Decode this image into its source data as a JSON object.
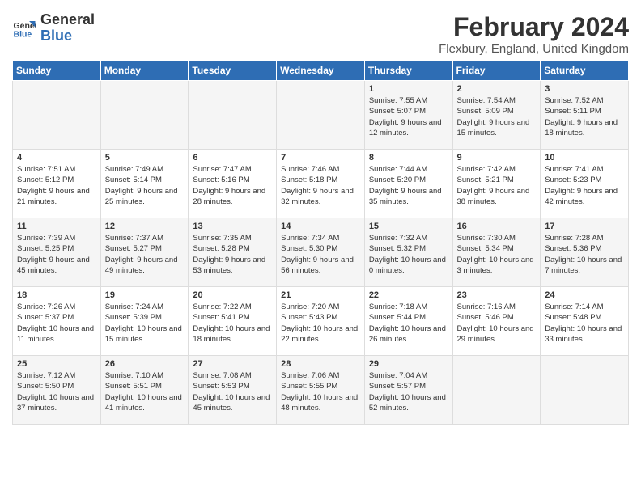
{
  "header": {
    "logo_line1": "General",
    "logo_line2": "Blue",
    "month_title": "February 2024",
    "location": "Flexbury, England, United Kingdom"
  },
  "weekdays": [
    "Sunday",
    "Monday",
    "Tuesday",
    "Wednesday",
    "Thursday",
    "Friday",
    "Saturday"
  ],
  "weeks": [
    [
      {
        "day": "",
        "sunrise": "",
        "sunset": "",
        "daylight": ""
      },
      {
        "day": "",
        "sunrise": "",
        "sunset": "",
        "daylight": ""
      },
      {
        "day": "",
        "sunrise": "",
        "sunset": "",
        "daylight": ""
      },
      {
        "day": "",
        "sunrise": "",
        "sunset": "",
        "daylight": ""
      },
      {
        "day": "1",
        "sunrise": "Sunrise: 7:55 AM",
        "sunset": "Sunset: 5:07 PM",
        "daylight": "Daylight: 9 hours and 12 minutes."
      },
      {
        "day": "2",
        "sunrise": "Sunrise: 7:54 AM",
        "sunset": "Sunset: 5:09 PM",
        "daylight": "Daylight: 9 hours and 15 minutes."
      },
      {
        "day": "3",
        "sunrise": "Sunrise: 7:52 AM",
        "sunset": "Sunset: 5:11 PM",
        "daylight": "Daylight: 9 hours and 18 minutes."
      }
    ],
    [
      {
        "day": "4",
        "sunrise": "Sunrise: 7:51 AM",
        "sunset": "Sunset: 5:12 PM",
        "daylight": "Daylight: 9 hours and 21 minutes."
      },
      {
        "day": "5",
        "sunrise": "Sunrise: 7:49 AM",
        "sunset": "Sunset: 5:14 PM",
        "daylight": "Daylight: 9 hours and 25 minutes."
      },
      {
        "day": "6",
        "sunrise": "Sunrise: 7:47 AM",
        "sunset": "Sunset: 5:16 PM",
        "daylight": "Daylight: 9 hours and 28 minutes."
      },
      {
        "day": "7",
        "sunrise": "Sunrise: 7:46 AM",
        "sunset": "Sunset: 5:18 PM",
        "daylight": "Daylight: 9 hours and 32 minutes."
      },
      {
        "day": "8",
        "sunrise": "Sunrise: 7:44 AM",
        "sunset": "Sunset: 5:20 PM",
        "daylight": "Daylight: 9 hours and 35 minutes."
      },
      {
        "day": "9",
        "sunrise": "Sunrise: 7:42 AM",
        "sunset": "Sunset: 5:21 PM",
        "daylight": "Daylight: 9 hours and 38 minutes."
      },
      {
        "day": "10",
        "sunrise": "Sunrise: 7:41 AM",
        "sunset": "Sunset: 5:23 PM",
        "daylight": "Daylight: 9 hours and 42 minutes."
      }
    ],
    [
      {
        "day": "11",
        "sunrise": "Sunrise: 7:39 AM",
        "sunset": "Sunset: 5:25 PM",
        "daylight": "Daylight: 9 hours and 45 minutes."
      },
      {
        "day": "12",
        "sunrise": "Sunrise: 7:37 AM",
        "sunset": "Sunset: 5:27 PM",
        "daylight": "Daylight: 9 hours and 49 minutes."
      },
      {
        "day": "13",
        "sunrise": "Sunrise: 7:35 AM",
        "sunset": "Sunset: 5:28 PM",
        "daylight": "Daylight: 9 hours and 53 minutes."
      },
      {
        "day": "14",
        "sunrise": "Sunrise: 7:34 AM",
        "sunset": "Sunset: 5:30 PM",
        "daylight": "Daylight: 9 hours and 56 minutes."
      },
      {
        "day": "15",
        "sunrise": "Sunrise: 7:32 AM",
        "sunset": "Sunset: 5:32 PM",
        "daylight": "Daylight: 10 hours and 0 minutes."
      },
      {
        "day": "16",
        "sunrise": "Sunrise: 7:30 AM",
        "sunset": "Sunset: 5:34 PM",
        "daylight": "Daylight: 10 hours and 3 minutes."
      },
      {
        "day": "17",
        "sunrise": "Sunrise: 7:28 AM",
        "sunset": "Sunset: 5:36 PM",
        "daylight": "Daylight: 10 hours and 7 minutes."
      }
    ],
    [
      {
        "day": "18",
        "sunrise": "Sunrise: 7:26 AM",
        "sunset": "Sunset: 5:37 PM",
        "daylight": "Daylight: 10 hours and 11 minutes."
      },
      {
        "day": "19",
        "sunrise": "Sunrise: 7:24 AM",
        "sunset": "Sunset: 5:39 PM",
        "daylight": "Daylight: 10 hours and 15 minutes."
      },
      {
        "day": "20",
        "sunrise": "Sunrise: 7:22 AM",
        "sunset": "Sunset: 5:41 PM",
        "daylight": "Daylight: 10 hours and 18 minutes."
      },
      {
        "day": "21",
        "sunrise": "Sunrise: 7:20 AM",
        "sunset": "Sunset: 5:43 PM",
        "daylight": "Daylight: 10 hours and 22 minutes."
      },
      {
        "day": "22",
        "sunrise": "Sunrise: 7:18 AM",
        "sunset": "Sunset: 5:44 PM",
        "daylight": "Daylight: 10 hours and 26 minutes."
      },
      {
        "day": "23",
        "sunrise": "Sunrise: 7:16 AM",
        "sunset": "Sunset: 5:46 PM",
        "daylight": "Daylight: 10 hours and 29 minutes."
      },
      {
        "day": "24",
        "sunrise": "Sunrise: 7:14 AM",
        "sunset": "Sunset: 5:48 PM",
        "daylight": "Daylight: 10 hours and 33 minutes."
      }
    ],
    [
      {
        "day": "25",
        "sunrise": "Sunrise: 7:12 AM",
        "sunset": "Sunset: 5:50 PM",
        "daylight": "Daylight: 10 hours and 37 minutes."
      },
      {
        "day": "26",
        "sunrise": "Sunrise: 7:10 AM",
        "sunset": "Sunset: 5:51 PM",
        "daylight": "Daylight: 10 hours and 41 minutes."
      },
      {
        "day": "27",
        "sunrise": "Sunrise: 7:08 AM",
        "sunset": "Sunset: 5:53 PM",
        "daylight": "Daylight: 10 hours and 45 minutes."
      },
      {
        "day": "28",
        "sunrise": "Sunrise: 7:06 AM",
        "sunset": "Sunset: 5:55 PM",
        "daylight": "Daylight: 10 hours and 48 minutes."
      },
      {
        "day": "29",
        "sunrise": "Sunrise: 7:04 AM",
        "sunset": "Sunset: 5:57 PM",
        "daylight": "Daylight: 10 hours and 52 minutes."
      },
      {
        "day": "",
        "sunrise": "",
        "sunset": "",
        "daylight": ""
      },
      {
        "day": "",
        "sunrise": "",
        "sunset": "",
        "daylight": ""
      }
    ]
  ]
}
